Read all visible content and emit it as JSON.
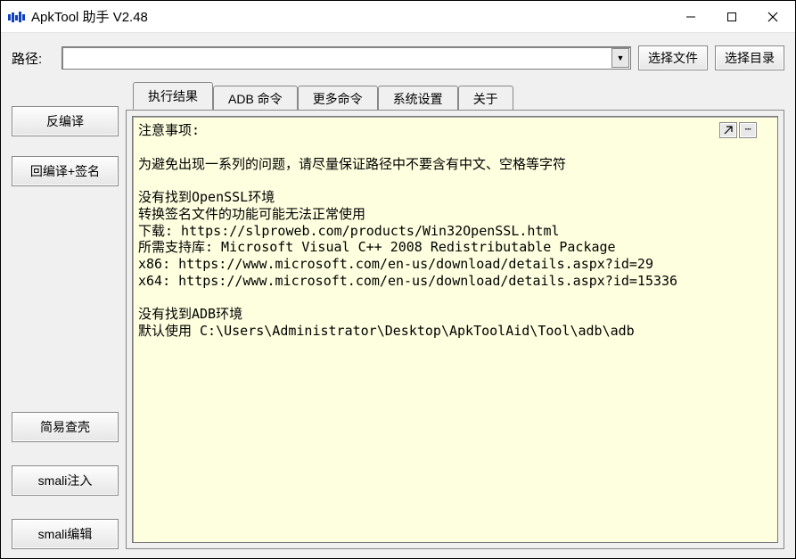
{
  "titlebar": {
    "title": "ApkTool 助手 V2.48"
  },
  "pathrow": {
    "label": "路径:",
    "value": "",
    "select_file": "选择文件",
    "select_dir": "选择目录"
  },
  "sidebar": {
    "decompile": "反编译",
    "recompile_sign": "回编译+签名",
    "shell_check": "简易查壳",
    "smali_inject": "smali注入",
    "smali_edit": "smali编辑"
  },
  "tabs": {
    "result": "执行结果",
    "adb": "ADB 命令",
    "more": "更多命令",
    "settings": "系统设置",
    "about": "关于"
  },
  "output_text": "注意事项:\n\n为避免出现一系列的问题，请尽量保证路径中不要含有中文、空格等字符\n\n没有找到OpenSSL环境\n转换签名文件的功能可能无法正常使用\n下载: https://slproweb.com/products/Win32OpenSSL.html\n所需支持库: Microsoft Visual C++ 2008 Redistributable Package\nx86: https://www.microsoft.com/en-us/download/details.aspx?id=29\nx64: https://www.microsoft.com/en-us/download/details.aspx?id=15336\n\n没有找到ADB环境\n默认使用 C:\\Users\\Administrator\\Desktop\\ApkToolAid\\Tool\\adb\\adb\n"
}
